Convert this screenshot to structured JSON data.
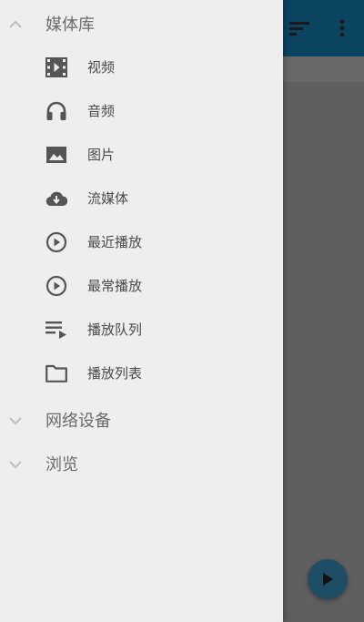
{
  "colors": {
    "toolbar": "#0b4461",
    "drawer_bg": "#eeeeee",
    "icon": "#555555",
    "section_text": "#6b6b6b",
    "fab": "#1f4d66"
  },
  "toolbar": {
    "icons": [
      "sort-icon",
      "more-vert-icon"
    ]
  },
  "drawer": {
    "sections": [
      {
        "label": "媒体库",
        "expanded": true,
        "items": [
          {
            "label": "视频",
            "icon": "movie-icon"
          },
          {
            "label": "音频",
            "icon": "headphones-icon"
          },
          {
            "label": "图片",
            "icon": "image-icon"
          },
          {
            "label": "流媒体",
            "icon": "cloud-download-icon"
          },
          {
            "label": "最近播放",
            "icon": "play-circle-icon"
          },
          {
            "label": "最常播放",
            "icon": "play-circle-icon"
          },
          {
            "label": "播放队列",
            "icon": "playlist-play-icon"
          },
          {
            "label": "播放列表",
            "icon": "folder-icon"
          }
        ]
      },
      {
        "label": "网络设备",
        "expanded": false
      },
      {
        "label": "浏览",
        "expanded": false
      }
    ]
  },
  "fab": {
    "icon": "play-icon"
  }
}
